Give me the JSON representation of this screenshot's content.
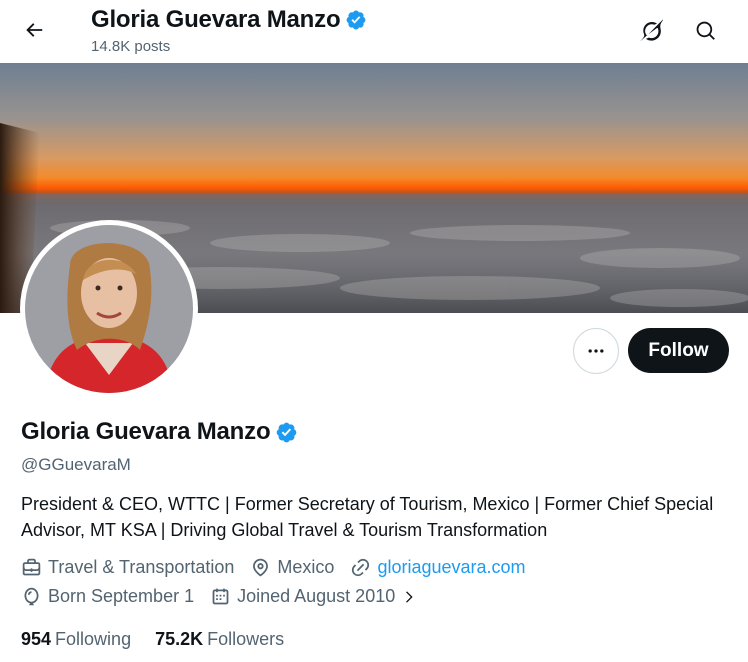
{
  "header": {
    "name": "Gloria Guevara Manzo",
    "posts": "14.8K posts"
  },
  "profile": {
    "name": "Gloria Guevara Manzo",
    "handle": "@GGuevaraM",
    "bio": "President & CEO, WTTC | Former Secretary of Tourism, Mexico | Former Chief Special Advisor, MT KSA | Driving Global Travel & Tourism Transformation",
    "category": "Travel & Transportation",
    "location": "Mexico",
    "website": "gloriaguevara.com",
    "birthday": "Born September 1",
    "joined": "Joined August 2010"
  },
  "actions": {
    "follow_label": "Follow"
  },
  "stats": {
    "following_count": "954",
    "following_label": "Following",
    "followers_count": "75.2K",
    "followers_label": "Followers"
  },
  "colors": {
    "accent": "#1d9bf0",
    "text": "#0f1419",
    "muted": "#536471",
    "follow_bg": "#0f1419"
  },
  "icons": [
    "back-arrow-icon",
    "verified-badge-icon",
    "grok-icon",
    "search-icon",
    "more-icon",
    "briefcase-icon",
    "location-pin-icon",
    "link-icon",
    "balloon-icon",
    "calendar-icon",
    "chevron-right-icon"
  ]
}
